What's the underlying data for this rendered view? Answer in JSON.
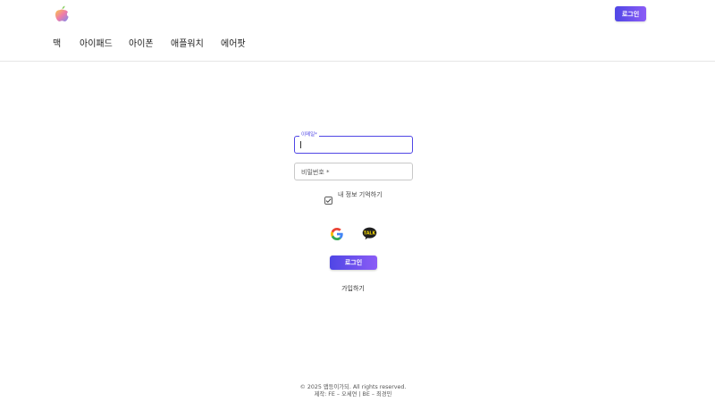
{
  "header": {
    "logo_icon": "apple-logo-icon",
    "login_label": "로그인"
  },
  "nav": {
    "items": [
      {
        "label": "맥"
      },
      {
        "label": "아이패드"
      },
      {
        "label": "아이폰"
      },
      {
        "label": "애플워치"
      },
      {
        "label": "에어팟"
      }
    ]
  },
  "form": {
    "email_label": "이메일*",
    "email_value": "",
    "password_label": "비밀번호 *",
    "remember_label": "내 정보 기억하기",
    "remember_checked": true,
    "social": [
      {
        "icon": "google-icon"
      },
      {
        "icon": "kakao-talk-icon",
        "label": "TALK"
      }
    ],
    "login_label": "로그인",
    "signup_label": "가입하기"
  },
  "footer": {
    "copyright": "© 2025 앱등이가되. All rights reserved.",
    "credits": "제작: FE – 오세연 | BE – 최경민"
  },
  "colors": {
    "accent_start": "#4f46e5",
    "accent_end": "#8b5cf6",
    "kakao_bg": "#1f1f1f",
    "kakao_text": "#f7d900"
  }
}
